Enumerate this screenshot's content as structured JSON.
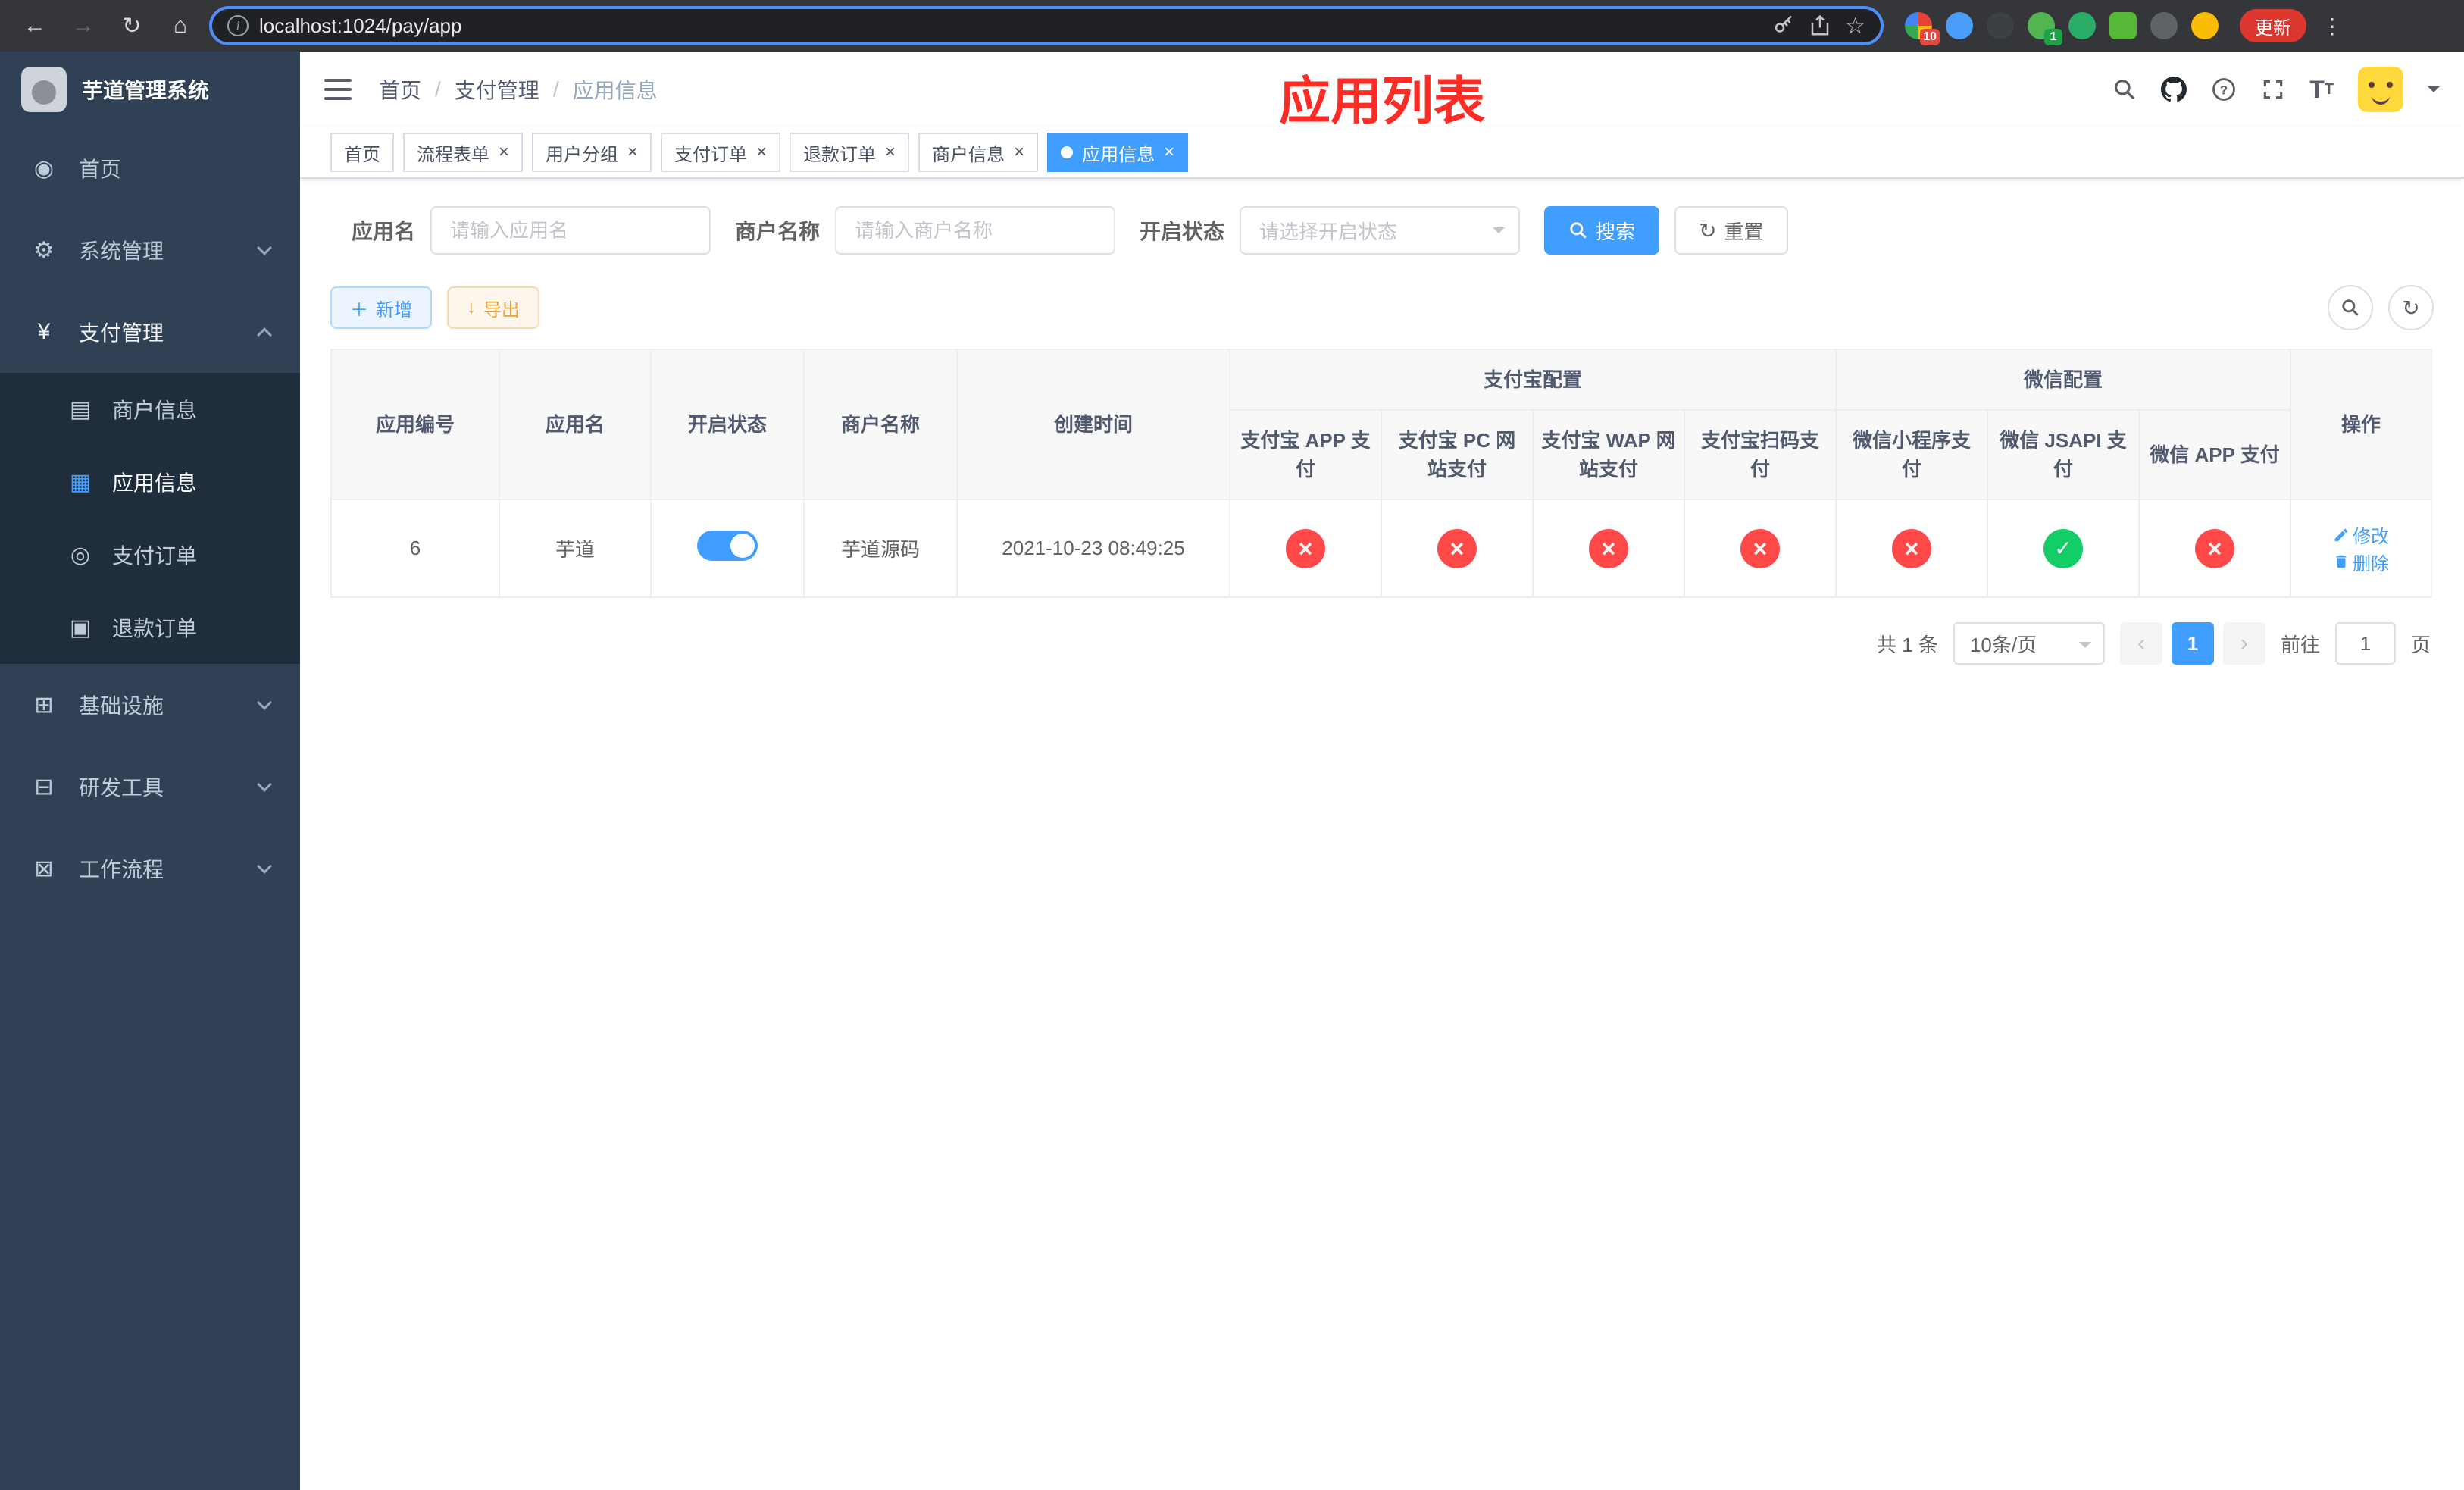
{
  "browser": {
    "url": "localhost:1024/pay/app",
    "update_label": "更新",
    "extension_badges": {
      "red": "10",
      "green": "1"
    }
  },
  "sidebar": {
    "title": "芋道管理系统",
    "menu": [
      {
        "label": "首页"
      },
      {
        "label": "系统管理"
      },
      {
        "label": "支付管理"
      },
      {
        "label": "基础设施"
      },
      {
        "label": "研发工具"
      },
      {
        "label": "工作流程"
      }
    ],
    "submenu": [
      {
        "label": "商户信息"
      },
      {
        "label": "应用信息"
      },
      {
        "label": "支付订单"
      },
      {
        "label": "退款订单"
      }
    ]
  },
  "header": {
    "breadcrumb": [
      "首页",
      "支付管理",
      "应用信息"
    ],
    "annotation": "应用列表"
  },
  "tabs": [
    {
      "label": "首页"
    },
    {
      "label": "流程表单"
    },
    {
      "label": "用户分组"
    },
    {
      "label": "支付订单"
    },
    {
      "label": "退款订单"
    },
    {
      "label": "商户信息"
    },
    {
      "label": "应用信息"
    }
  ],
  "filters": {
    "app_name_label": "应用名",
    "app_name_placeholder": "请输入应用名",
    "merchant_label": "商户名称",
    "merchant_placeholder": "请输入商户名称",
    "status_label": "开启状态",
    "status_placeholder": "请选择开启状态",
    "search_label": "搜索",
    "reset_label": "重置"
  },
  "toolbar": {
    "add_label": "新增",
    "export_label": "导出"
  },
  "table": {
    "groups": {
      "alipay": "支付宝配置",
      "wechat": "微信配置"
    },
    "headers": [
      "应用编号",
      "应用名",
      "开启状态",
      "商户名称",
      "创建时间",
      "支付宝 APP 支付",
      "支付宝 PC 网站支付",
      "支付宝 WAP 网站支付",
      "支付宝扫码支付",
      "微信小程序支付",
      "微信 JSAPI 支付",
      "微信 APP 支付",
      "操作"
    ],
    "row": {
      "id": "6",
      "name": "芋道",
      "enabled": "on",
      "merchant": "芋道源码",
      "created_at": "2021-10-23 08:49:25",
      "configs": {
        "alipay_app": "disabled",
        "alipay_pc": "disabled",
        "alipay_wap": "disabled",
        "alipay_qr": "disabled",
        "wechat_lite": "disabled",
        "wechat_jsapi": "enabled",
        "wechat_app": "disabled"
      },
      "edit_label": "修改",
      "delete_label": "删除"
    }
  },
  "pagination": {
    "total": "共 1 条",
    "page_size": "10条/页",
    "page": "1",
    "goto_prefix": "前往",
    "goto_value": "1",
    "goto_suffix": "页"
  },
  "colors": {
    "accent": "#409eff",
    "success": "#13ce66",
    "danger": "#ff4949",
    "warning": "#e6a23c",
    "sidebar_bg": "#304156",
    "sidebar_sub_bg": "#1f2d3d",
    "annotation_red": "#fe2c25",
    "update_button": "#dc362e"
  }
}
